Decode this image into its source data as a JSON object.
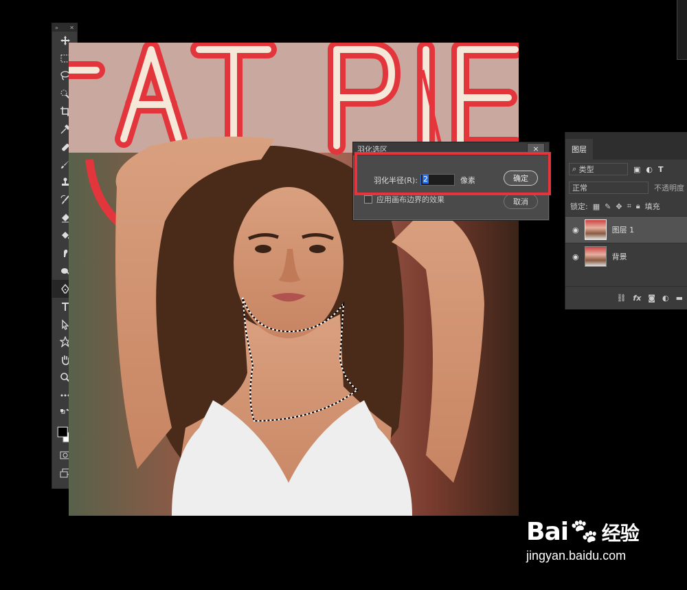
{
  "tools": [
    "move",
    "marquee",
    "lasso",
    "quick-select",
    "crop",
    "eyedropper",
    "healing",
    "brush",
    "stamp",
    "history-brush",
    "eraser",
    "paint-bucket",
    "smudge",
    "dodge",
    "pen",
    "type",
    "path-select",
    "shape",
    "hand",
    "zoom",
    "more",
    "swap",
    "colors",
    "quickmask",
    "screen-mode"
  ],
  "dialog": {
    "title": "羽化选区",
    "close": "×",
    "radius_label": "羽化半径(R):",
    "radius_value": "2",
    "unit": "像素",
    "ok": "确定",
    "cancel": "取消",
    "checkbox_label": "应用画布边界的效果"
  },
  "layers": {
    "tab": "图层",
    "filter_kind": "类型",
    "blend_mode": "正常",
    "opacity_label": "不透明度",
    "lock_label": "锁定:",
    "fill_label": "填充",
    "items": [
      {
        "name": "图层 1",
        "selected": true
      },
      {
        "name": "背景",
        "selected": false
      }
    ],
    "footer_fx": "fx"
  },
  "watermark": {
    "brand": "Bai",
    "brand_tail": "经验",
    "url": "jingyan.baidu.com"
  },
  "colors": {
    "highlight": "#e8333d",
    "selection": "#2e6ee6"
  }
}
